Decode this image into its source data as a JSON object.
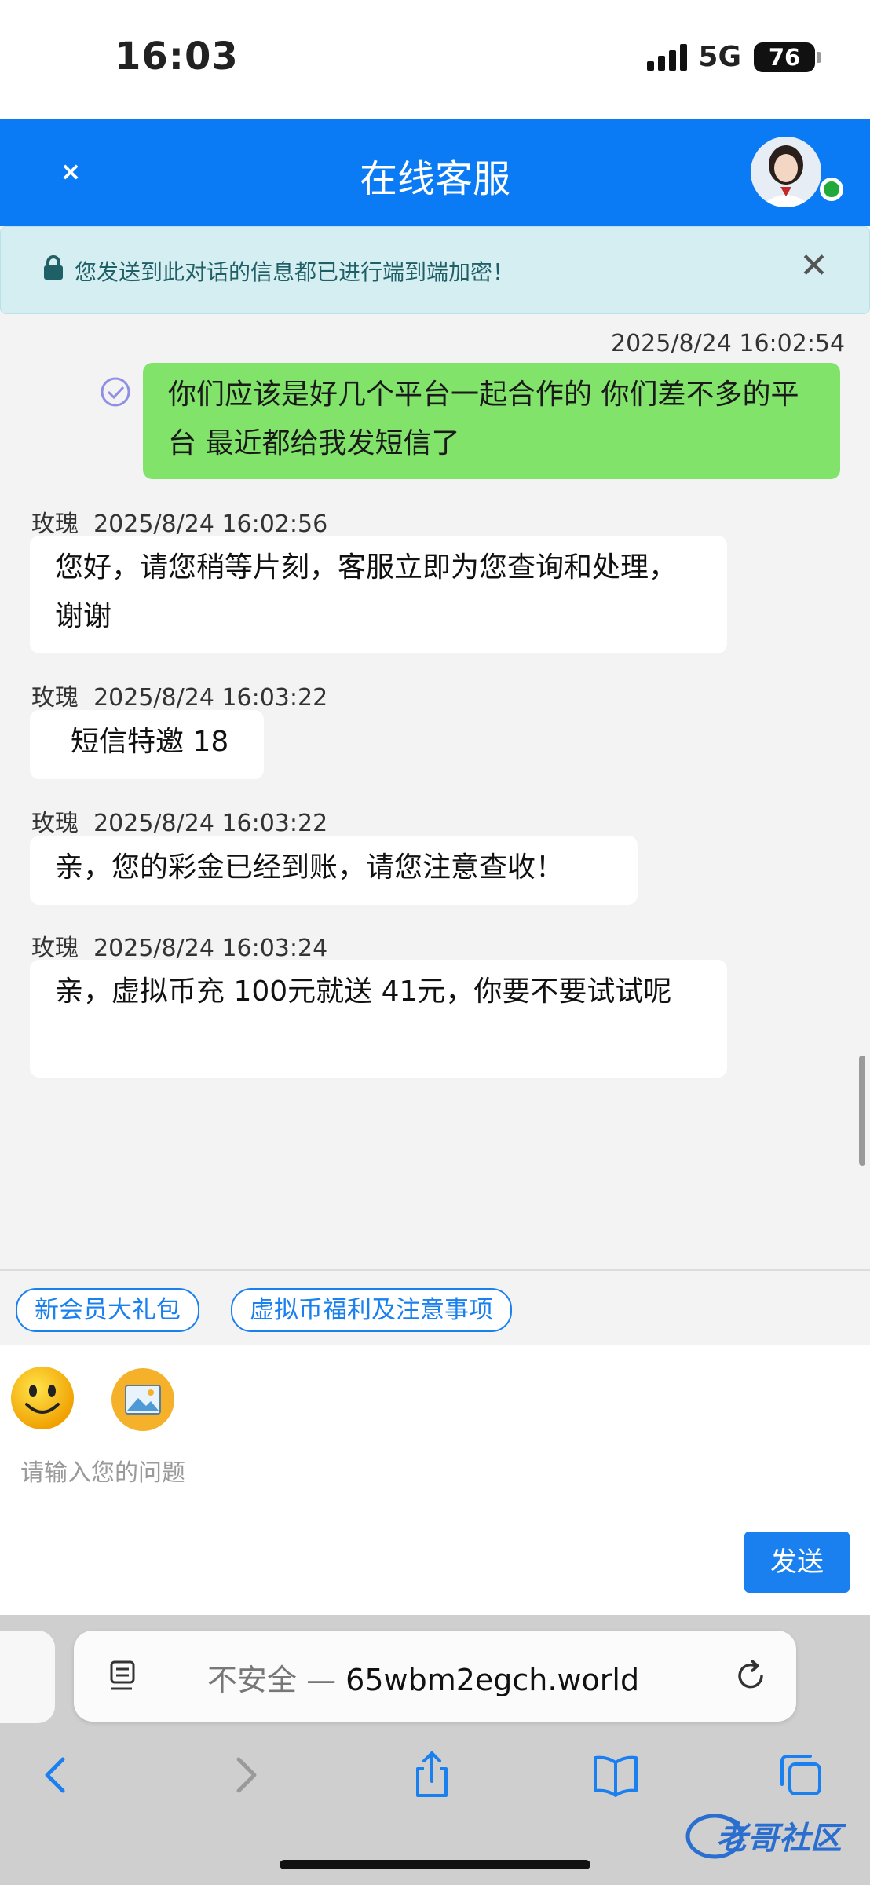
{
  "status_bar": {
    "time": "16:03",
    "network": "5G",
    "battery": "76"
  },
  "header": {
    "close_symbol": "×",
    "title": "在线客服"
  },
  "notice": {
    "text": "您发送到此对话的信息都已进行端到端加密！",
    "close_symbol": "✕"
  },
  "messages": [
    {
      "role": "user",
      "time": "2025/8/24 16:02:54",
      "text": "你们应该是好几个平台一起合作的 你们差不多的平台 最近都给我发短信了"
    },
    {
      "role": "agent",
      "sender": "玫瑰",
      "time": "2025/8/24 16:02:56",
      "text": "您好，请您稍等片刻，客服立即为您查询和处理，谢谢"
    },
    {
      "role": "agent",
      "sender": "玫瑰",
      "time": "2025/8/24 16:03:22",
      "text": "短信特邀 18"
    },
    {
      "role": "agent",
      "sender": "玫瑰",
      "time": "2025/8/24 16:03:22",
      "text": "亲，您的彩金已经到账，请您注意查收！"
    },
    {
      "role": "agent",
      "sender": "玫瑰",
      "time": "2025/8/24 16:03:24",
      "text": "亲，虚拟币充 100元就送 41元，你要不要试试呢"
    }
  ],
  "quick_replies": [
    "新会员大礼包",
    "虚拟币福利及注意事项"
  ],
  "composer": {
    "placeholder": "请输入您的问题",
    "send_label": "发送"
  },
  "browser": {
    "insecure_label": "不安全 — ",
    "domain": "65wbm2egch.world"
  },
  "watermark": "老哥社区",
  "colors": {
    "header": "#0a7bf5",
    "user_bubble": "#82e36b",
    "accent": "#1a80f0",
    "online": "#1faa3a"
  }
}
